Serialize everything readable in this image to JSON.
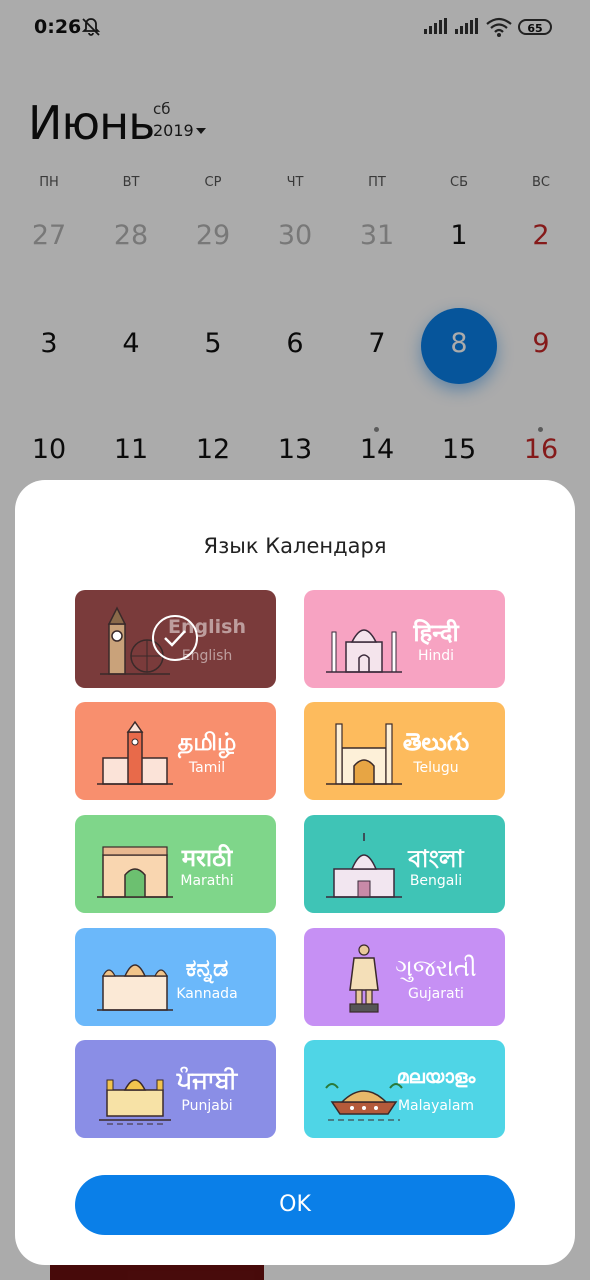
{
  "status_bar": {
    "time": "0:26",
    "battery": "65"
  },
  "calendar": {
    "month": "Июнь",
    "weekday_short": "сб",
    "year": "2019",
    "weekdays": [
      "ПН",
      "ВТ",
      "СР",
      "ЧТ",
      "ПТ",
      "СБ",
      "ВС"
    ],
    "weeks": [
      [
        "27",
        "28",
        "29",
        "30",
        "31",
        "1",
        "2"
      ],
      [
        "3",
        "4",
        "5",
        "6",
        "7",
        "8",
        "9"
      ],
      [
        "10",
        "11",
        "12",
        "13",
        "14",
        "15",
        "16"
      ]
    ],
    "selected_day": "8"
  },
  "dialog": {
    "title": "Язык Календаря",
    "ok_label": "OK",
    "languages": [
      {
        "script": "English",
        "name": "English",
        "color": "#7a3b3b",
        "selected": true,
        "icon": "big-ben-icon"
      },
      {
        "script": "हिन्दी",
        "name": "Hindi",
        "color": "#f7a3c2",
        "selected": false,
        "icon": "taj-mahal-icon"
      },
      {
        "script": "தமிழ்",
        "name": "Tamil",
        "color": "#f88f6e",
        "selected": false,
        "icon": "chennai-central-icon"
      },
      {
        "script": "తెలుగు",
        "name": "Telugu",
        "color": "#fdbb5d",
        "selected": false,
        "icon": "charminar-icon"
      },
      {
        "script": "मराठी",
        "name": "Marathi",
        "color": "#7fd68a",
        "selected": false,
        "icon": "gateway-of-india-icon"
      },
      {
        "script": "বাংলা",
        "name": "Bengali",
        "color": "#3fc4b6",
        "selected": false,
        "icon": "victoria-memorial-icon"
      },
      {
        "script": "ಕನ್ನಡ",
        "name": "Kannada",
        "color": "#6bb8fa",
        "selected": false,
        "icon": "mysore-palace-icon"
      },
      {
        "script": "ગુજરાતી",
        "name": "Gujarati",
        "color": "#c690f4",
        "selected": false,
        "icon": "statue-of-unity-icon"
      },
      {
        "script": "ਪੰਜਾਬੀ",
        "name": "Punjabi",
        "color": "#8a8ee6",
        "selected": false,
        "icon": "golden-temple-icon"
      },
      {
        "script": "മലയാളം",
        "name": "Malayalam",
        "color": "#4fd5e6",
        "selected": false,
        "icon": "houseboat-icon"
      }
    ]
  }
}
